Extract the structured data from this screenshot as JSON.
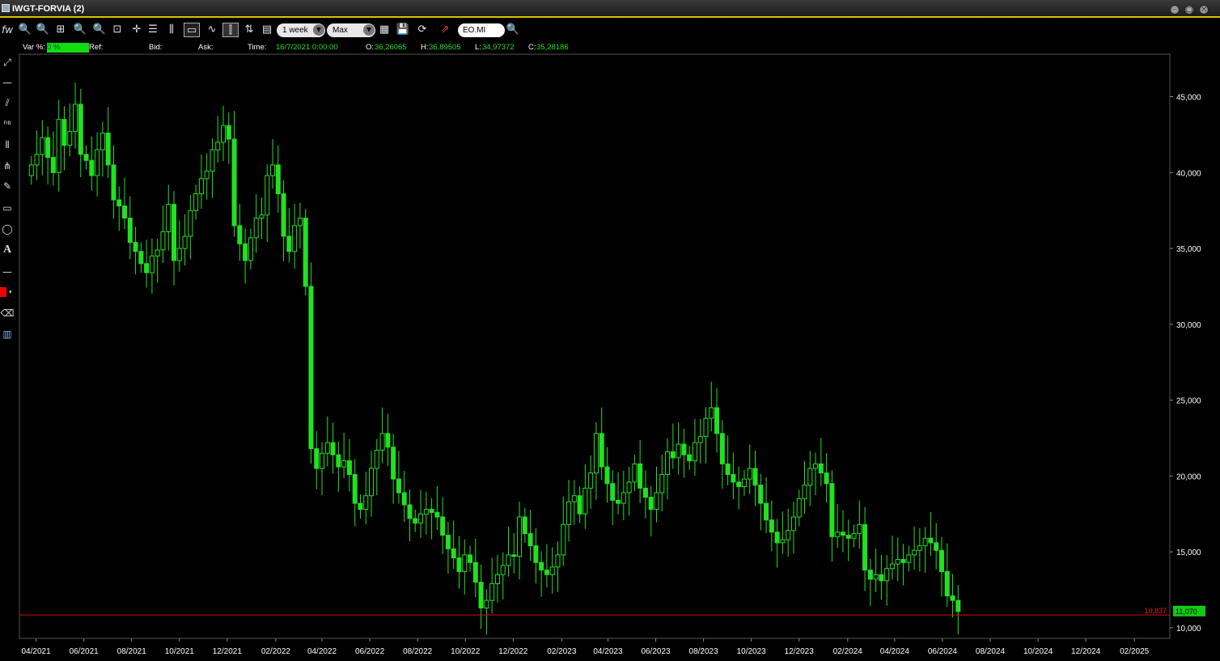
{
  "window": {
    "title": "IWGT-FORVIA (2)"
  },
  "toolbar": {
    "period": "1 week",
    "range": "Max",
    "ticker": "EO.MI",
    "icons": [
      "function-icon",
      "zoom-in-icon",
      "zoom-out-icon",
      "zoom-fit-icon",
      "zoom-x-icon",
      "zoom-y-icon",
      "zoom-all-icon",
      "crosshair-icon",
      "list-icon",
      "volume-icon",
      "window-icon",
      "line-chart-icon",
      "candle-icon",
      "indicator-icon",
      "legend-icon",
      "print-icon",
      "save-icon",
      "refresh-icon",
      "export-icon",
      "search-icon"
    ]
  },
  "infobar": {
    "var_label": "Var %:",
    "var_value": "0 %",
    "ref_label": "Ref:",
    "bid_label": "Bid:",
    "ask_label": "Ask:",
    "time_label": "Time:",
    "time_value": "16/7/2021 0:00:00",
    "open_label": "O:",
    "open_value": "36,26065",
    "high_label": "H:",
    "high_value": "36,89505",
    "low_label": "L:",
    "low_value": "34,97372",
    "close_label": "C:",
    "close_value": "35,28186"
  },
  "left_tools": [
    "resize-icon",
    "horizontal-line-icon",
    "trend-line-icon",
    "fibonacci-icon",
    "vertical-lines-icon",
    "pitchfork-icon",
    "pencil-icon",
    "rectangle-icon",
    "ellipse-icon",
    "text-icon",
    "line-width-icon",
    "color-picker-icon",
    "eraser-icon",
    "trash-icon"
  ],
  "left_tools_text": {
    "fib": "FIB",
    "text": "A"
  },
  "colors": {
    "candle": "#22e022",
    "reference_line": "#d01010",
    "price_box": "#11cc11",
    "axis_text": "#ffffff"
  },
  "chart_data": {
    "type": "candlestick",
    "title": "",
    "x_ticks": [
      "04/2021",
      "06/2021",
      "08/2021",
      "10/2021",
      "12/2021",
      "02/2022",
      "04/2022",
      "06/2022",
      "08/2022",
      "10/2022",
      "12/2022",
      "02/2023",
      "04/2023",
      "06/2023",
      "08/2023",
      "10/2023",
      "12/2023",
      "02/2024",
      "04/2024",
      "06/2024",
      "08/2024",
      "10/2024",
      "12/2024",
      "02/2025"
    ],
    "y_ticks": [
      "45,000",
      "40,000",
      "35,000",
      "30,000",
      "25,000",
      "20,000",
      "15,000",
      "10,000"
    ],
    "y_tick_values": [
      45,
      40,
      35,
      30,
      25,
      20,
      15,
      10
    ],
    "ylim": [
      9.3,
      47.8
    ],
    "x_start": "2021-03-19",
    "x_end": "2025-03-10",
    "reference_line": {
      "value": 10.837,
      "label": "10,837"
    },
    "last_price": {
      "value": 11.07,
      "label": "11,070"
    },
    "weekly_close": [
      40.5,
      41.2,
      42.3,
      41,
      40,
      43.5,
      41.8,
      42.7,
      44.5,
      41.2,
      40.8,
      39.8,
      41.5,
      42.6,
      40.5,
      38.2,
      37.8,
      37,
      35.4,
      34.8,
      34,
      33.4,
      34.5,
      34.9,
      36.1,
      37.9,
      34.2,
      35,
      35.8,
      37.5,
      38.6,
      39.6,
      40.1,
      41.5,
      42,
      43.1,
      42.2,
      36.5,
      35.3,
      34.2,
      35.7,
      37,
      37.2,
      39.8,
      40.5,
      38.6,
      35.8,
      34.8,
      36.5,
      37,
      32.5,
      21.8,
      20.5,
      21.5,
      22.2,
      21.4,
      20.6,
      21,
      20.1,
      18.2,
      17.8,
      18.7,
      20.5,
      21.7,
      22.8,
      21.9,
      19.8,
      18.9,
      18.1,
      17.2,
      16.9,
      17.5,
      17.8,
      17.6,
      17.3,
      16.1,
      15.2,
      14.6,
      13.7,
      14.8,
      14.3,
      13,
      11.3,
      11.8,
      12.9,
      13.5,
      14.1,
      14.8,
      14.7,
      17.3,
      16.2,
      15.4,
      14.3,
      13.8,
      13.5,
      14,
      14.8,
      16.8,
      18.3,
      18.7,
      17.5,
      19.2,
      20.2,
      22.8,
      20.6,
      19.5,
      18.4,
      18.2,
      18.9,
      19.6,
      20.8,
      19.2,
      18.6,
      17.8,
      18.9,
      20.1,
      21.6,
      21.2,
      22.1,
      21.4,
      21,
      22.2,
      22.6,
      23.8,
      24.5,
      22.8,
      20.8,
      20.1,
      19.6,
      19.3,
      19.8,
      20.5,
      19.4,
      18.2,
      17.1,
      16.3,
      15.6,
      15.8,
      16.4,
      17.3,
      18.5,
      19.4,
      20.5,
      20.8,
      20.2,
      19.5,
      16,
      16.3,
      16.1,
      15.9,
      16.2,
      16.8,
      13.8,
      13.2,
      13.5,
      13.1,
      13.9,
      14.2,
      14.5,
      14.3,
      14.8,
      15.1,
      15.4,
      15.9,
      15.6,
      15.1,
      13.7,
      12.1,
      11.8,
      11.07
    ],
    "weekly_open": [
      39.8,
      40.5,
      41.2,
      42.3,
      41,
      40,
      43.5,
      41.8,
      42.7,
      44.5,
      41.2,
      40.8,
      39.8,
      41.5,
      42.6,
      40.5,
      38.2,
      37.8,
      37,
      35.4,
      34.8,
      34,
      33.4,
      34.5,
      34.9,
      36.1,
      37.9,
      34.2,
      35,
      35.8,
      37.5,
      38.6,
      39.6,
      40.1,
      41.5,
      42,
      43.1,
      42.2,
      36.5,
      35.3,
      34.2,
      35.7,
      37,
      37.2,
      39.8,
      40.5,
      38.6,
      35.8,
      34.8,
      36.5,
      37,
      32.5,
      21.8,
      20.5,
      21.5,
      22.2,
      21.4,
      20.6,
      21,
      20.1,
      18.2,
      17.8,
      18.7,
      20.5,
      21.7,
      22.8,
      21.9,
      19.8,
      18.9,
      18.1,
      17.2,
      16.9,
      17.5,
      17.8,
      17.6,
      17.3,
      16.1,
      15.2,
      14.6,
      13.7,
      14.8,
      14.3,
      13,
      11.3,
      11.8,
      12.9,
      13.5,
      14.1,
      14.8,
      14.7,
      17.3,
      16.2,
      15.4,
      14.3,
      13.8,
      13.5,
      14,
      14.8,
      16.8,
      18.3,
      18.7,
      17.5,
      19.2,
      20.2,
      22.8,
      20.6,
      19.5,
      18.4,
      18.2,
      18.9,
      19.6,
      20.8,
      19.2,
      18.6,
      17.8,
      18.9,
      20.1,
      21.6,
      21.2,
      22.1,
      21.4,
      21,
      22.2,
      22.6,
      23.8,
      24.5,
      22.8,
      20.8,
      20.1,
      19.6,
      19.3,
      19.8,
      20.5,
      19.4,
      18.2,
      17.1,
      16.3,
      15.6,
      15.8,
      16.4,
      17.3,
      18.5,
      19.4,
      20.5,
      20.8,
      20.2,
      19.5,
      16,
      16.3,
      16.1,
      15.9,
      16.2,
      16.8,
      13.8,
      13.2,
      13.5,
      13.1,
      13.9,
      14.2,
      14.5,
      14.3,
      14.8,
      15.1,
      15.4,
      15.9,
      15.6,
      15.1,
      13.7,
      12.1,
      11.8
    ]
  }
}
